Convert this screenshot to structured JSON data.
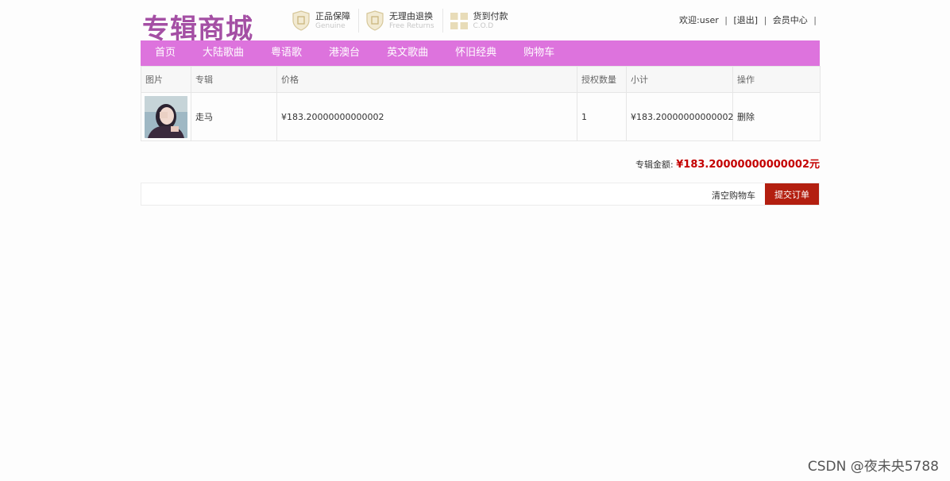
{
  "header": {
    "logo": "专辑商城",
    "badges": [
      {
        "icon": "shield-genuine-icon",
        "title": "正品保障",
        "subtitle": "Genuine"
      },
      {
        "icon": "shield-return-icon",
        "title": "无理由退换",
        "subtitle": "Free Returns"
      },
      {
        "icon": "gift-cod-icon",
        "title": "货到付款",
        "subtitle": "C.O.D"
      }
    ],
    "user": {
      "welcome": "欢迎:user",
      "logout": "[退出]",
      "member_center": "会员中心",
      "separator": "|"
    }
  },
  "nav": {
    "items": [
      "首页",
      "大陆歌曲",
      "粤语歌",
      "港澳台",
      "英文歌曲",
      "怀旧经典",
      "购物车"
    ]
  },
  "cart": {
    "headers": [
      "图片",
      "专辑",
      "价格",
      "授权数量",
      "小计",
      "操作"
    ],
    "rows": [
      {
        "image": "album-cover-thumbnail",
        "album": "走马",
        "price": "¥183.20000000000002",
        "quantity": "1",
        "subtotal": "¥183.20000000000002",
        "action": "删除"
      }
    ]
  },
  "summary": {
    "label": "专辑金额:",
    "amount": "¥183.20000000000002元"
  },
  "actions": {
    "clear": "清空购物车",
    "submit": "提交订单"
  },
  "watermark": "CSDN @夜未央5788",
  "colors": {
    "logo": "#a44fa4",
    "nav_bg": "#dd73dd",
    "amount": "#c40000",
    "submit_bg": "#b31f10"
  }
}
